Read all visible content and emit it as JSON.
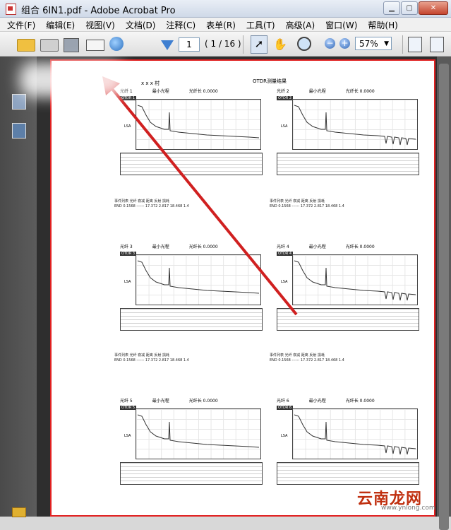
{
  "window": {
    "title": "组合 6IN1.pdf - Adobe Acrobat Pro"
  },
  "menu": [
    "文件(F)",
    "编辑(E)",
    "视图(V)",
    "文档(D)",
    "注释(C)",
    "表单(R)",
    "工具(T)",
    "高级(A)",
    "窗口(W)",
    "帮助(H)"
  ],
  "toolbar": {
    "page_current": "1",
    "page_total": "( 1 / 16 )",
    "zoom": "57%"
  },
  "document": {
    "village_label": "x x x 村",
    "title": "OTDR测量结果",
    "panels": [
      {
        "header": [
          "光纤 1",
          "最小光程",
          "光纤长 0.0000"
        ],
        "tag": "OTDR 1",
        "unit": "LSA"
      },
      {
        "header": [
          "光纤 2",
          "最小光程",
          "光纤长 0.0000"
        ],
        "tag": "OTDR 2",
        "unit": "LSA"
      },
      {
        "header": [
          "光纤 3",
          "最小光程",
          "光纤长 0.0000"
        ],
        "tag": "OTDR 3",
        "unit": "LSA"
      },
      {
        "header": [
          "光纤 4",
          "最小光程",
          "光纤长 0.0000"
        ],
        "tag": "OTDR 4",
        "unit": "LSA"
      },
      {
        "header": [
          "光纤 5",
          "最小光程",
          "光纤长 0.0000"
        ],
        "tag": "OTDR 5",
        "unit": "LSA"
      },
      {
        "header": [
          "光纤 6",
          "最小光程",
          "光纤长 0.0000"
        ],
        "tag": "OTDR 6",
        "unit": "LSA"
      }
    ],
    "summary_rows": [
      "事件列表    光纤   衰减   距离   反射   损耗",
      "END  0.1568  ------  17.372  2.817  18.468  1.4"
    ]
  },
  "watermark": {
    "text": "云南龙网",
    "sub": "www.ynlong.com"
  }
}
